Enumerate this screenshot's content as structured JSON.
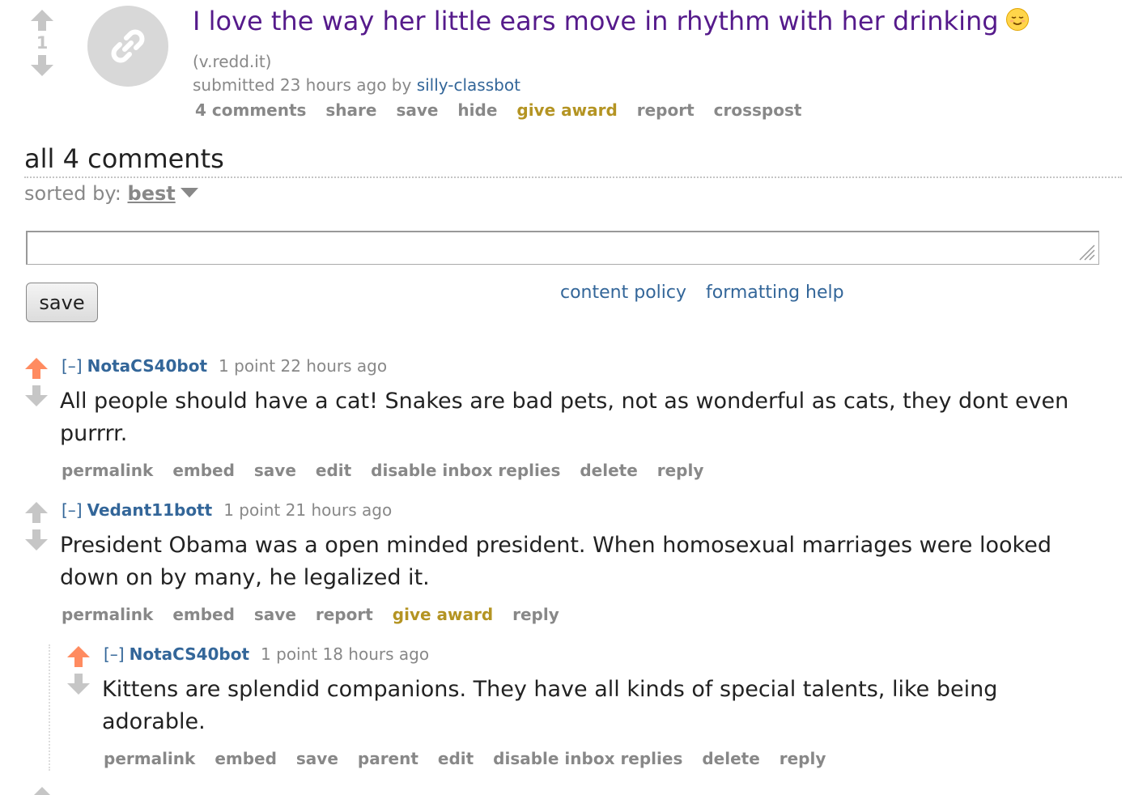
{
  "post": {
    "score": "1",
    "title": "I love the way her little ears move in rhythm with her drinking",
    "domain": "(v.redd.it)",
    "submitted_prefix": "submitted 23 hours ago by",
    "author": "silly-classbot",
    "actions": [
      "4 comments",
      "share",
      "save",
      "hide",
      "give award",
      "report",
      "crosspost"
    ]
  },
  "comments_header": {
    "title": "all 4 comments",
    "sorted_label": "sorted by:",
    "sort_value": "best"
  },
  "editor": {
    "value": "",
    "save_label": "save",
    "content_policy": "content policy",
    "formatting_help": "formatting help"
  },
  "comments": [
    {
      "toggle": "[–]",
      "author": "NotaCS40bot",
      "meta": "1 point 22 hours ago",
      "body": "All people should have a cat! Snakes are bad pets, not as wonderful as cats, they dont even purrrr.",
      "actions": [
        "permalink",
        "embed",
        "save",
        "edit",
        "disable inbox replies",
        "delete",
        "reply"
      ]
    },
    {
      "toggle": "[–]",
      "author": "Vedant11bott",
      "meta": "1 point 21 hours ago",
      "body": "President Obama was a open minded president. When homosexual marriages were looked down on by many, he legalized it.",
      "actions": [
        "permalink",
        "embed",
        "save",
        "report",
        "give award",
        "reply"
      ]
    },
    {
      "toggle": "[–]",
      "author": "NotaCS40bot",
      "meta": "1 point 18 hours ago",
      "body": "Kittens are splendid companions. They have all kinds of special talents, like being adorable.",
      "actions": [
        "permalink",
        "embed",
        "save",
        "parent",
        "edit",
        "disable inbox replies",
        "delete",
        "reply"
      ]
    }
  ],
  "colors": {
    "link": "#336699",
    "visited_title": "#551a8b",
    "award": "#b49423",
    "upvoted": "#ff8b60",
    "muted": "#888888"
  }
}
